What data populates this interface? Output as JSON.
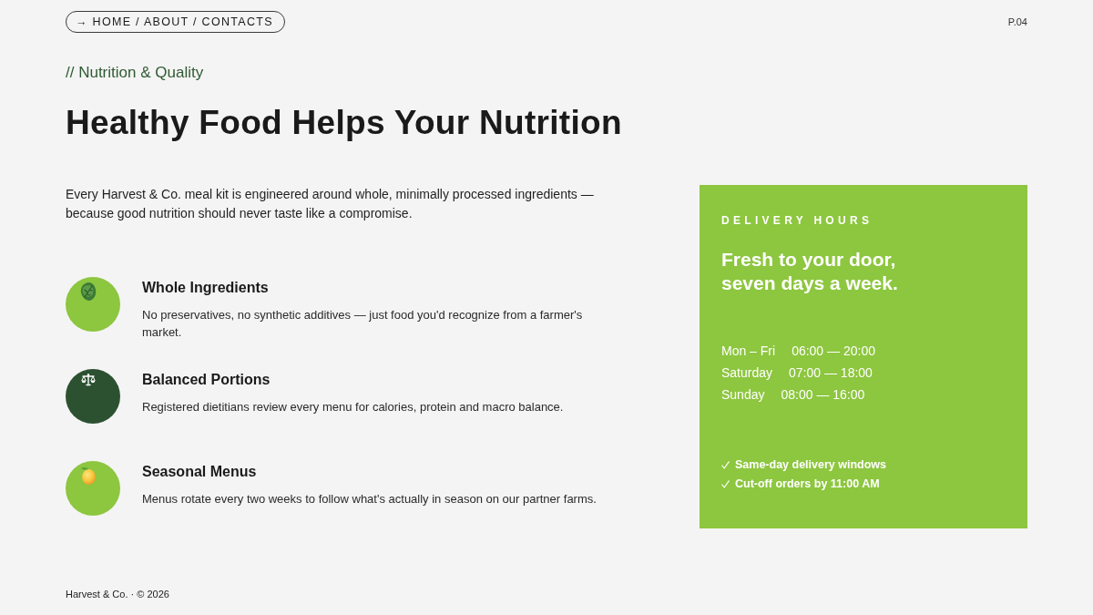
{
  "breadcrumb": "→ HOME / ABOUT / CONTACTS",
  "page_number": "P.04",
  "eyebrow": "// Nutrition & Quality",
  "heading": "Healthy Food Helps Your Nutrition",
  "intro": "Every Harvest & Co. meal kit is engineered around whole, minimally processed ingredients — because good nutrition should never taste like a compromise.",
  "features": [
    {
      "title": "Whole Ingredients",
      "description": "No preservatives, no synthetic additives — just food you'd recognize from a farmer's market.",
      "color": "#8dc63f"
    },
    {
      "title": "Balanced Portions",
      "description": "Registered dietitians review every menu for calories, protein and macro balance.",
      "color": "#2c5130"
    },
    {
      "title": "Seasonal Menus",
      "description": "Menus rotate every two weeks to follow what's actually in season on our partner farms.",
      "color": "#8dc63f"
    }
  ],
  "delivery_card": {
    "eyebrow": "DELIVERY HOURS",
    "headline_lines": [
      "Fresh to your door,",
      "seven days a week."
    ],
    "hours": [
      {
        "day": "Mon – Fri",
        "time": "06:00 — 20:00"
      },
      {
        "day": "Saturday",
        "time": "07:00 — 18:00"
      },
      {
        "day": "Sunday",
        "time": "08:00 — 16:00"
      }
    ],
    "perks": [
      "Same-day delivery windows",
      "Cut-off orders by 11:00 AM"
    ]
  },
  "footer": "Harvest & Co. · © 2026"
}
